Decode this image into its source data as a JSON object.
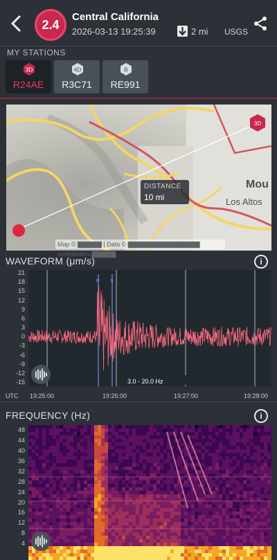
{
  "header": {
    "magnitude": "2.4",
    "title": "Central California",
    "datetime": "2026-03-13 19:25:39",
    "depth": "2 mi",
    "source": "USGS",
    "icons": {
      "back": "chevron-left-icon",
      "share": "share-icon",
      "depth": "arrow-down-icon"
    }
  },
  "stations": {
    "label": "MY STATIONS",
    "items": [
      {
        "badge": "3D",
        "code": "R24AE",
        "selected": true,
        "color": "#c8284f"
      },
      {
        "badge": "4D",
        "code": "R3C71",
        "selected": false,
        "color": "#d9dde0"
      },
      {
        "badge": "B",
        "code": "RE991",
        "selected": false,
        "color": "#d9dde0"
      }
    ]
  },
  "map": {
    "distance_label": "DISTANCE",
    "distance_value": "10 mi",
    "station_marker": "3D",
    "place_1": "Mou",
    "place_2": "Los Altos",
    "attribution": "Map © ▇▇▇▇▇ | Data © ▇▇▇▇▇▇▇▇▇▇▇▇▇▇▇ contributors ▇▇▇▇▇"
  },
  "waveform": {
    "title": "WAVEFORM (μm/s)",
    "y_ticks": [
      "21",
      "18",
      "15",
      "12",
      "9",
      "6",
      "3",
      "0",
      "-3",
      "-6",
      "-9",
      "-12",
      "-15"
    ],
    "x_ticks": [
      "19:25:00",
      "19:26:00",
      "19:27:00",
      "19:28:00"
    ],
    "x_prefix": "UTC",
    "filter": "3.0 - 20.0 Hz",
    "phase_p": "P",
    "phase_s": "S",
    "trace_color": "#ff6b80"
  },
  "frequency": {
    "title": "FREQUENCY (Hz)",
    "y_ticks": [
      "48",
      "44",
      "40",
      "36",
      "32",
      "28",
      "24",
      "20",
      "16",
      "12",
      "8",
      "4"
    ]
  },
  "chart_data": [
    {
      "type": "line",
      "title": "WAVEFORM (μm/s)",
      "xlabel": "UTC",
      "x": [
        "19:25:00",
        "19:26:00",
        "19:27:00",
        "19:28:00"
      ],
      "ylim": [
        -15,
        21
      ],
      "series": [
        {
          "values": [
            2,
            21,
            4,
            3
          ]
        }
      ]
    },
    {
      "type": "heatmap",
      "title": "FREQUENCY (Hz)",
      "xlabel": "UTC",
      "x": [
        "19:25:00",
        "19:26:00",
        "19:27:00",
        "19:28:00"
      ],
      "ylim": [
        0,
        50
      ]
    }
  ]
}
